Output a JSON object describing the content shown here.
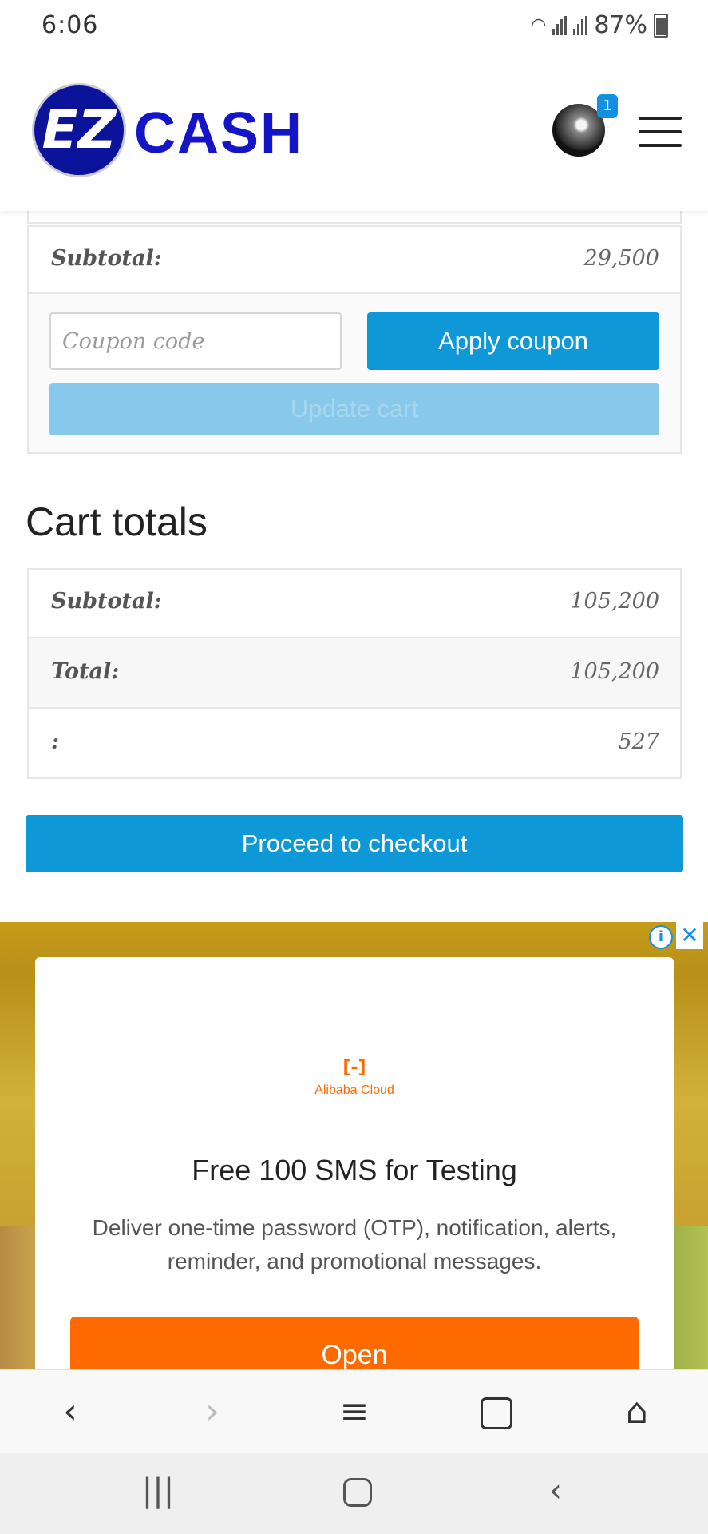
{
  "status_bar": {
    "time": "6:06",
    "battery": "87%"
  },
  "header": {
    "logo_mark": "EZ",
    "logo_text": "CASH",
    "cart_badge": "1"
  },
  "cart_table": {
    "subtotal_label": "Subtotal:",
    "subtotal_value": "29,500"
  },
  "coupon": {
    "placeholder": "Coupon code",
    "apply_label": "Apply coupon",
    "update_label": "Update cart"
  },
  "cart_totals": {
    "heading": "Cart totals",
    "rows": [
      {
        "label": "Subtotal:",
        "value": "105,200"
      },
      {
        "label": "Total:",
        "value": "105,200"
      },
      {
        "label": ":",
        "value": "527"
      }
    ],
    "checkout_label": "Proceed to checkout"
  },
  "ad": {
    "brand": "Alibaba Cloud",
    "title": "Free 100 SMS for Testing",
    "description": "Deliver one-time password (OTP), notification, alerts, reminder, and promotional messages.",
    "cta": "Open"
  },
  "icons": {
    "toolbar": [
      "back-icon",
      "forward-icon",
      "menu-icon",
      "tabs-icon",
      "home-icon"
    ],
    "system_nav": [
      "recents-icon",
      "home-button-icon",
      "system-back-icon"
    ]
  },
  "colors": {
    "primary_button": "#0e98d8",
    "logo_blue": "#1414c8",
    "ad_cta": "#ff6a00"
  }
}
